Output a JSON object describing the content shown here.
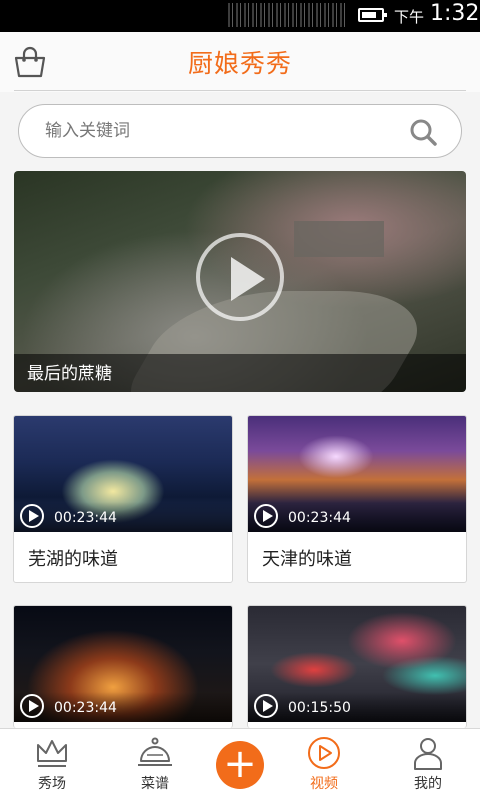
{
  "status_bar": {
    "ampm": "下午",
    "time": "1:32"
  },
  "header": {
    "title": "厨娘秀秀"
  },
  "search": {
    "placeholder": "输入关键词"
  },
  "featured": {
    "caption": "最后的蔗糖"
  },
  "videos": [
    {
      "title": "芜湖的味道",
      "duration": "00:23:44"
    },
    {
      "title": "天津的味道",
      "duration": "00:23:44"
    },
    {
      "title": "",
      "duration": "00:23:44"
    },
    {
      "title": "",
      "duration": "00:15:50"
    }
  ],
  "nav": [
    {
      "label": "秀场",
      "icon": "crown-icon"
    },
    {
      "label": "菜谱",
      "icon": "dish-cover-icon"
    },
    {
      "label": "+",
      "icon": "add-icon"
    },
    {
      "label": "视频",
      "icon": "video-play-icon"
    },
    {
      "label": "我的",
      "icon": "user-icon"
    }
  ],
  "colors": {
    "accent": "#f26c1a"
  }
}
